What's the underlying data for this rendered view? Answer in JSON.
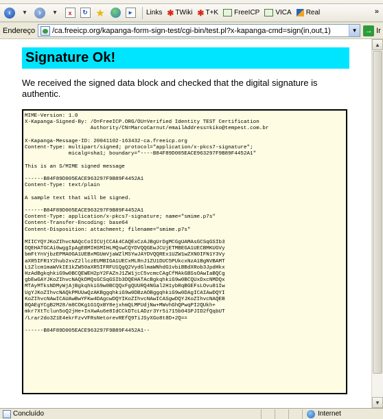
{
  "toolbar": {
    "links_label": "Links",
    "links": [
      {
        "label": "TWiki"
      },
      {
        "label": "T+K"
      },
      {
        "label": "FreeICP"
      },
      {
        "label": "VICA"
      },
      {
        "label": "Real"
      }
    ],
    "overflow": "»"
  },
  "address": {
    "label": "Endereço",
    "url": "/ca.freeicp.org/kapanga-form-sign-test/cgi-bin/test.pl?x-kapanga-cmd=sign(in,out,1)",
    "go_label": "Ir"
  },
  "page": {
    "heading": "Signature Ok!",
    "intro": "We received the signed data block and checked that the digital signature is authentic.",
    "signed_block": "MIME-Version: 1.0\nX-Kapanga-Signed-By: /O=FreeICP.ORG/OU=Verified Identity TEST Certification\n                     Authority/CN=MarcoCarnut/emailAddress=kiko@tempest.com.br\n\nX-Kapanga-Message-ID: 20041102-163432-ca.freeicp.org\nContent-Type: multipart/signed; protocol=\"application/x-pkcs7-signature\";\n              micalg=sha1; boundary=\"----B84F89D005EACE963297F9B89F4452A1\"\n\nThis is an S/MIME signed message\n\n------B84F89D005EACE963297F9B89F4452A1\nContent-Type: text/plain\n\nA sample text that will be signed.\n\n------B84F89D005EACE963297F9B89F4452A1\nContent-Type: application/x-pkcs7-signature; name=\"smime.p7s\"\nContent-Transfer-Encoding: base64\nContent-Disposition: attachment; filename=\"smime.p7s\"\n\nMIICYQYJKoZIhvcNAQcCoIICUjCCAk4CAQExCzAJBgUrDgMCGgUAMAsGCSqGSIb3\nDQEHATGCAi0wggIpAgEBMIHSMIHLMQswCQYDVQQGEwJCUjETMBEGA1UECBMKUGVy\nbmFtYnVjbzEPMA0GA1UEBxMGUmVjaWZlMSYwJAYDVQQREx1UZW1wZXN0IFN1Y3Vy\naXR5IFR1Y2hub2xvZ2llczEUMBIGA1UECxMLRnJ1ZU1DUC5PUkcxNzA1BgNVBAMT\nL1Zlcm1maWVkIE1kZW50aXR5IFRFU1QgQ2VydGlmaWNhdG1vbiBBdXRob3JpdHkx\nHzAdBgkqhkiG9w0BCQEWEH2pY2FAZnJ1ZW1jcC5vcmcCAgCfMAkGBSsOAwIaBQCg\ngbEwGAYJKoZIhvcNAQkDMQsGCSqGSIb3DQEHATAcBgkqhkiG9w0BCQUxDxcNMDQx\nMTAyMTksNDMyWjAjBgkqhkiG9w0BCQQxFgQUURQ4NGal2H1ybRqBGEFsLOvu81Iw\nUgYJKoZIhvcNAQkPMUUwQzAKBggqhkiG9w0DBzAOBggqhkiG9w0DAgICAIAwDQYI\nKoZIhvcNAwICAUAwBwYFKw4DAgcwDQYIKoZIhvcNAwICASgwDQYJKoZIhvcNAQEB\nBQAEgYCgB2M28/m8COKg1G1QxBY8ejxhmQLMPUdjNw+MWvhGhQPwqPI2QUkh+\nmkr7XtTclun5oQ2jHe+InXwAu6e8IdCCkDTcLADzr3Yr5i715b04SPJID2fQqbUT\n/Lrar2do3Z1E4ekrFzvVFRsNetorevREfQ9TiJSyXGo8t8D+2Q==\n\n------B84F89D005EACE963297F9B89F4452A1--"
  },
  "status": {
    "text": "Concluído",
    "zone": "Internet"
  },
  "colors": {
    "heading_bg": "#00e5ff",
    "signed_block_bg": "#fefde4"
  },
  "icons": {
    "back": "back-arrow-icon",
    "forward": "forward-arrow-icon",
    "stop": "stop-icon",
    "refresh": "refresh-icon",
    "favorites": "star-icon",
    "history": "history-icon",
    "links": "link-bar-icon",
    "go": "go-arrow-icon"
  }
}
